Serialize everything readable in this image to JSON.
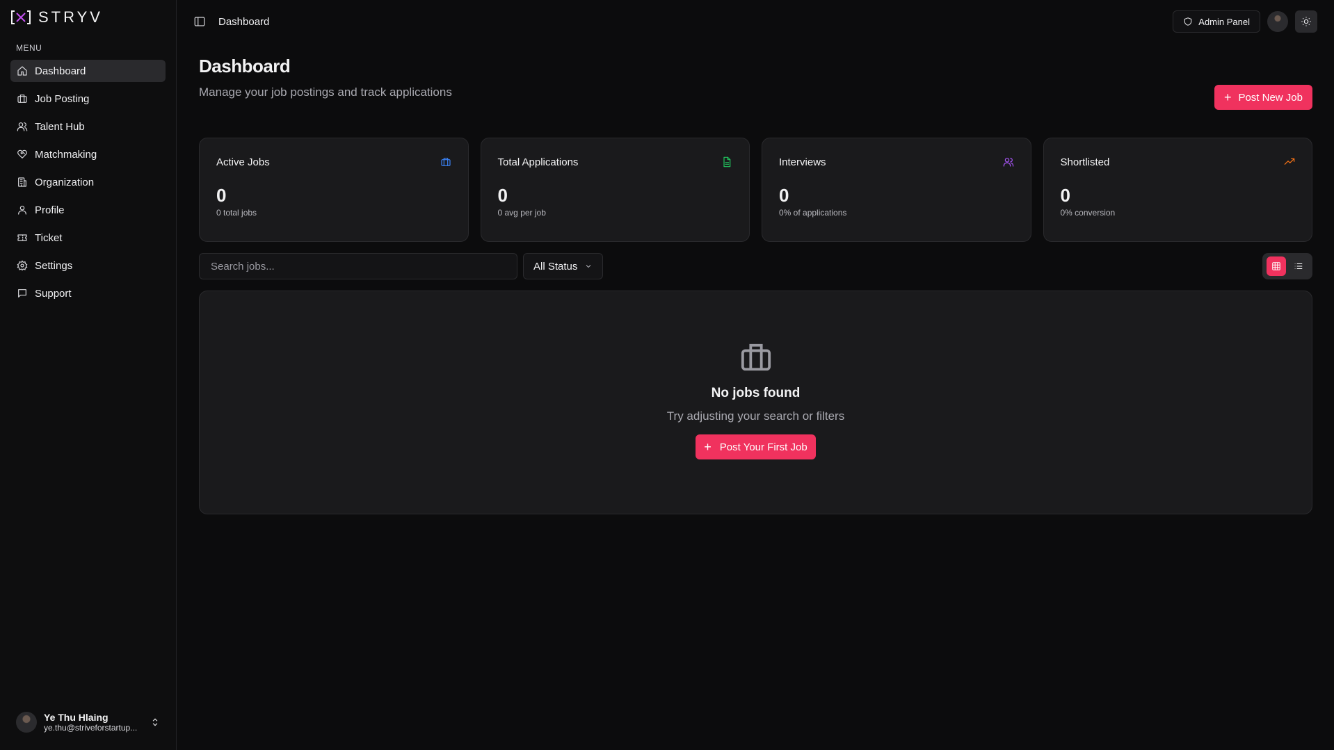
{
  "brand": {
    "name": "STRYV",
    "logo_mark": "[X]"
  },
  "sidebar": {
    "menu_label": "MENU",
    "items": [
      {
        "label": "Dashboard",
        "icon": "home-icon",
        "active": true
      },
      {
        "label": "Job Posting",
        "icon": "briefcase-icon"
      },
      {
        "label": "Talent Hub",
        "icon": "users-icon"
      },
      {
        "label": "Matchmaking",
        "icon": "handshake-icon"
      },
      {
        "label": "Organization",
        "icon": "building-icon"
      },
      {
        "label": "Profile",
        "icon": "user-icon"
      },
      {
        "label": "Ticket",
        "icon": "ticket-icon"
      },
      {
        "label": "Settings",
        "icon": "gear-icon"
      },
      {
        "label": "Support",
        "icon": "message-icon"
      }
    ],
    "user": {
      "name": "Ye Thu Hlaing",
      "email": "ye.thu@striveforstartup..."
    }
  },
  "topbar": {
    "breadcrumb": "Dashboard",
    "admin_label": "Admin Panel"
  },
  "page": {
    "title": "Dashboard",
    "subtitle": "Manage your job postings and track applications",
    "post_button": "Post New Job"
  },
  "stats": [
    {
      "title": "Active Jobs",
      "value": "0",
      "caption": "0 total jobs",
      "icon": "briefcase-icon",
      "color": "#3b82f6"
    },
    {
      "title": "Total Applications",
      "value": "0",
      "caption": "0 avg per job",
      "icon": "file-icon",
      "color": "#22c55e"
    },
    {
      "title": "Interviews",
      "value": "0",
      "caption": "0% of applications",
      "icon": "users-icon",
      "color": "#a855f7"
    },
    {
      "title": "Shortlisted",
      "value": "0",
      "caption": "0% conversion",
      "icon": "trending-up-icon",
      "color": "#f97316"
    }
  ],
  "filters": {
    "search_placeholder": "Search jobs...",
    "status_value": "All Status"
  },
  "empty_state": {
    "title": "No jobs found",
    "subtitle": "Try adjusting your search or filters",
    "button": "Post Your First Job"
  },
  "colors": {
    "accent": "#f0325e",
    "background": "#0c0c0d",
    "card": "#1a1a1c"
  }
}
